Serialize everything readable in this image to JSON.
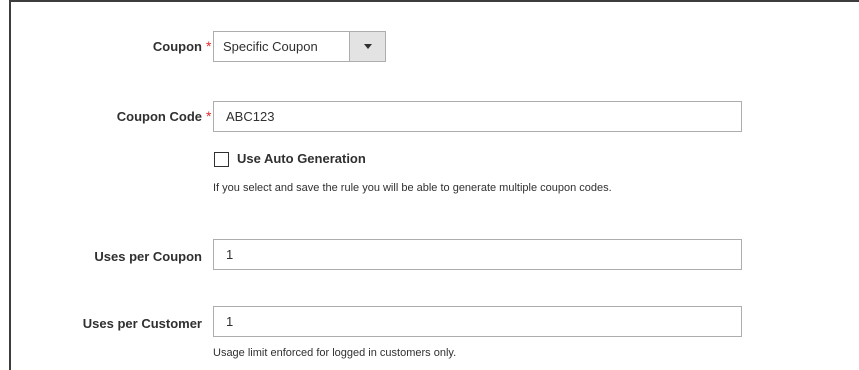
{
  "coupon": {
    "label": "Coupon",
    "required_mark": "*",
    "selected_value": "Specific Coupon",
    "dropdown_icon": "triangle-down-icon"
  },
  "coupon_code": {
    "label": "Coupon Code",
    "required_mark": "*",
    "value": "ABC123"
  },
  "auto_generation": {
    "label": "Use Auto Generation",
    "checked": false,
    "note": "If you select and save the rule you will be able to generate multiple coupon codes."
  },
  "uses_per_coupon": {
    "label": "Uses per Coupon",
    "value": "1"
  },
  "uses_per_customer": {
    "label": "Uses per Customer",
    "value": "1",
    "note": "Usage limit enforced for logged in customers only."
  },
  "colors": {
    "required": "#e22626",
    "border": "#adadad",
    "text": "#303030"
  }
}
